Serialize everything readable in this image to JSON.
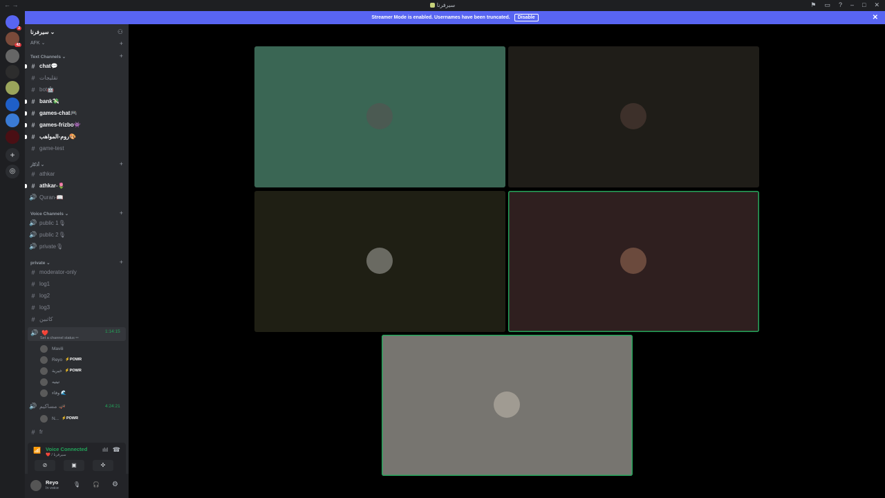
{
  "window": {
    "title": "سيرفرنا",
    "nav": "← →"
  },
  "banner": {
    "text": "Streamer Mode is enabled. Usernames have been truncated.",
    "button": "Disable",
    "close": "✕"
  },
  "guild_badges": {
    "first": "2",
    "second": "42"
  },
  "server": {
    "name": "سيرفرنا",
    "afk": "AFK"
  },
  "categories": {
    "text": "Text Channels",
    "athkar": "أذكار",
    "voice": "Voice Channels",
    "private": "private"
  },
  "channels": [
    {
      "name": "chat💬",
      "bright": true,
      "type": "text"
    },
    {
      "name": "تقليجات",
      "bright": false,
      "type": "text"
    },
    {
      "name": "bot🤖",
      "bright": false,
      "type": "text"
    },
    {
      "name": "bank💸",
      "bright": true,
      "type": "text"
    },
    {
      "name": "games-chat🎮",
      "bright": true,
      "type": "text"
    },
    {
      "name": "games-frizbo👾",
      "bright": true,
      "type": "text"
    },
    {
      "name": "روم-المواهب🎨",
      "bright": true,
      "type": "text"
    },
    {
      "name": "game-test",
      "bright": false,
      "type": "text"
    },
    {
      "name": "athkar",
      "bright": false,
      "type": "text"
    },
    {
      "name": "athkar-🌷",
      "bright": true,
      "type": "text"
    },
    {
      "name": "Quran-📖",
      "bright": false,
      "type": "voice"
    },
    {
      "name": "public 1🎙",
      "bright": false,
      "type": "voice"
    },
    {
      "name": "public 2🎙",
      "bright": false,
      "type": "voice"
    },
    {
      "name": "private🎙",
      "bright": false,
      "type": "voice"
    },
    {
      "name": "moderator-only",
      "bright": false,
      "type": "text"
    },
    {
      "name": "log1",
      "bright": false,
      "type": "text"
    },
    {
      "name": "log2",
      "bright": false,
      "type": "text"
    },
    {
      "name": "log3",
      "bright": false,
      "type": "text"
    },
    {
      "name": "كاتبين",
      "bright": false,
      "type": "text"
    }
  ],
  "active_voice": {
    "name": "❤️",
    "timer": "1:14:15",
    "status": "Set a channel status ✏",
    "members": [
      {
        "name": "Mavili",
        "powr": ""
      },
      {
        "name": "Reyo",
        "powr": "POWR"
      },
      {
        "name": "خيرية",
        "powr": "POWR"
      },
      {
        "name": "تيتيه",
        "powr": ""
      },
      {
        "name": "وفاء 🌊",
        "powr": ""
      }
    ]
  },
  "second_voice": {
    "name": "مساكيم 🛹",
    "timer": "4:24:21",
    "members": [
      {
        "name": "N...",
        "powr": "POWR"
      }
    ]
  },
  "last_channel": "fr",
  "voice_panel": {
    "title": "Voice Connected",
    "sub": "❤️ / سيرفرنا"
  },
  "user": {
    "name": "Reyo",
    "status": "In voice"
  },
  "tiles": [
    {
      "bg": "#3a6654",
      "avatar_color": "#4b5a52",
      "speaking": false
    },
    {
      "bg": "#1f1d18",
      "avatar_color": "#3d302a",
      "speaking": false
    },
    {
      "bg": "#1f1f14",
      "avatar_color": "#6a6a62",
      "speaking": false
    },
    {
      "bg": "#2f1f1f",
      "avatar_color": "#6b4a3d",
      "speaking": true
    },
    {
      "bg": "#777570",
      "avatar_color": "#a09b92",
      "speaking": true
    }
  ]
}
